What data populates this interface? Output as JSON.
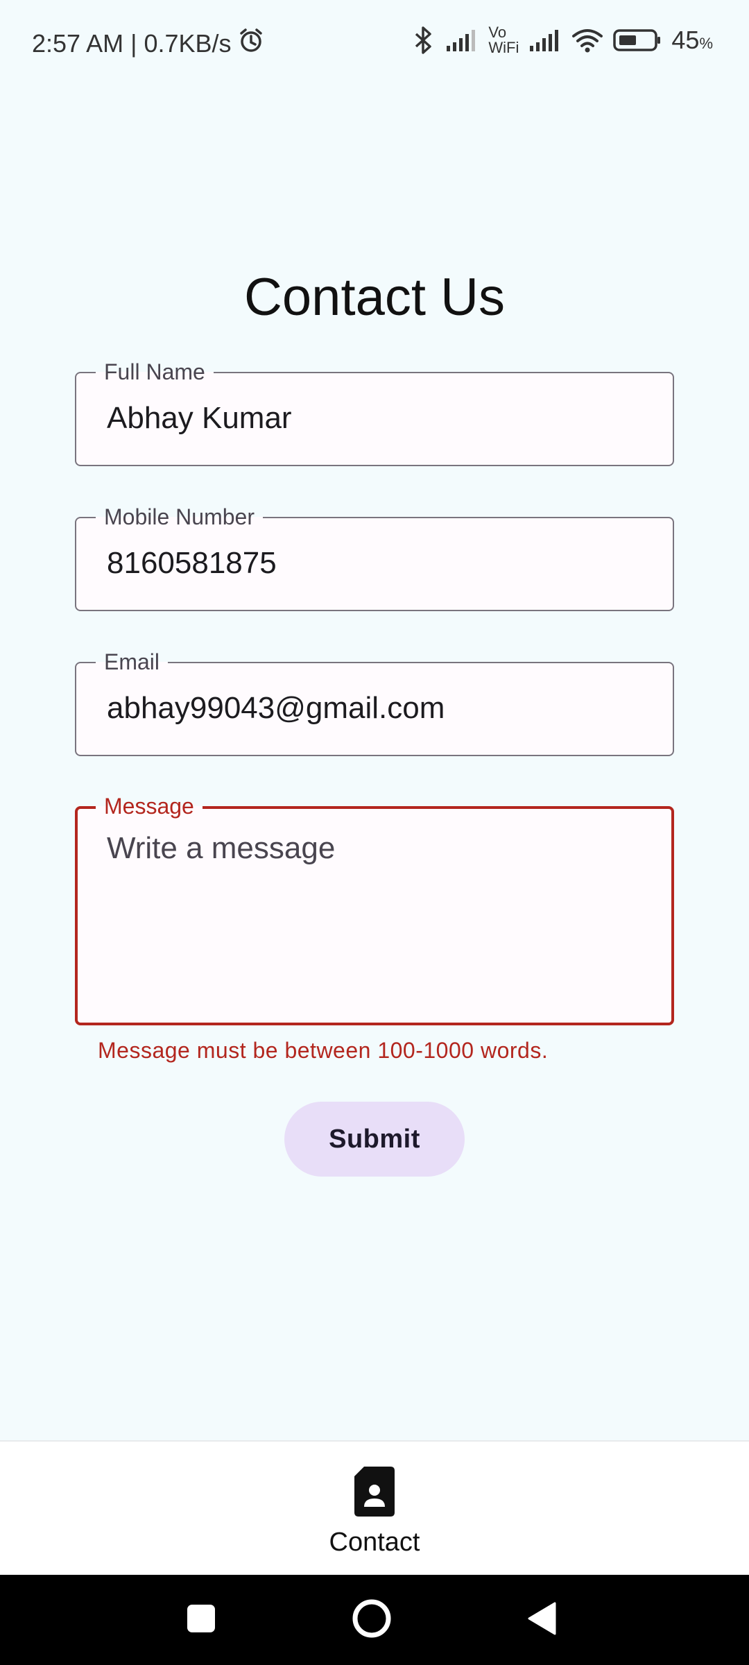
{
  "status_bar": {
    "time_speed": "2:57 AM | 0.7KB/s",
    "icons_left": [
      "alarm-icon"
    ],
    "icons_right": [
      "bluetooth-icon",
      "signal-icon",
      "vowifi-icon",
      "signal-icon",
      "wifi-icon",
      "battery-icon"
    ],
    "vowifi_top": "Vo",
    "vowifi_bottom": "WiFi",
    "battery_percent": "45",
    "battery_unit": "%"
  },
  "page": {
    "title": "Contact Us"
  },
  "form": {
    "full_name": {
      "label": "Full Name",
      "value": "Abhay Kumar"
    },
    "mobile": {
      "label": "Mobile Number",
      "value": "8160581875"
    },
    "email": {
      "label": "Email",
      "value": "abhay99043@gmail.com"
    },
    "message": {
      "label": "Message",
      "placeholder": "Write a message",
      "error": "Message must be between 100-1000 words."
    },
    "submit_label": "Submit"
  },
  "bottom_nav": {
    "items": [
      {
        "label": "Contact",
        "icon": "contact-file-icon"
      }
    ]
  },
  "system_nav": {
    "buttons": [
      "recents-square-icon",
      "home-circle-icon",
      "back-triangle-icon"
    ]
  },
  "colors": {
    "background": "#f3fbfd",
    "error": "#b3261e",
    "button_bg": "#e8def8",
    "field_border": "#79747e"
  }
}
